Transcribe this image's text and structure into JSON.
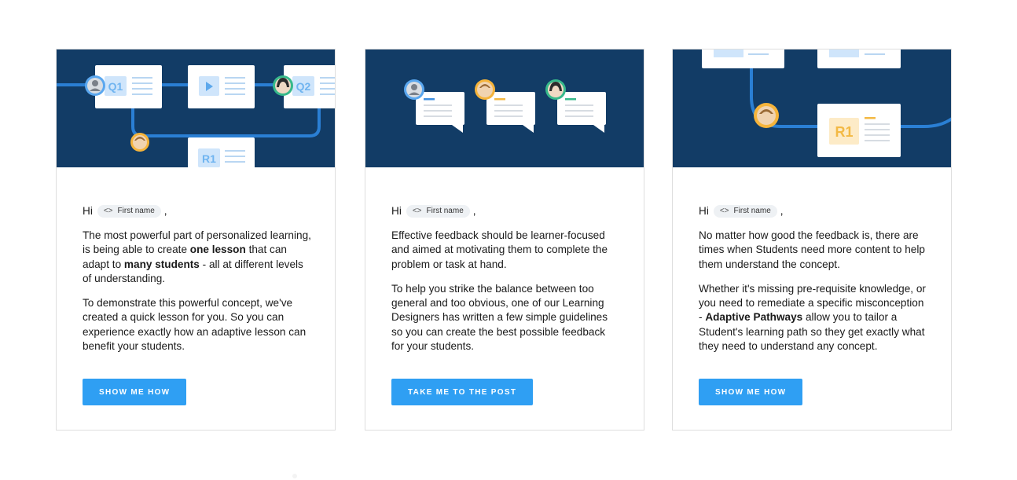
{
  "colors": {
    "hero_bg": "#123c66",
    "path": "#2a7fd4",
    "cta": "#2f9ff3",
    "q_badge": "#cfe5fb",
    "q_text": "#6fb4f0",
    "r_badge": "#fdebc7",
    "r_text": "#f3b944"
  },
  "cards": [
    {
      "greeting": "Hi",
      "chip_icon": "<>",
      "chip_label": "First name",
      "comma": ",",
      "p1": {
        "a": "The most powerful part of personalized learning, is being able to create ",
        "b": "one lesson",
        "c": " that can adapt to ",
        "d": "many students",
        "e": " - all at different levels of understanding."
      },
      "p2": "To demonstrate this powerful concept, we've created a quick lesson for you. So you can experience exactly how an adaptive lesson can benefit your students.",
      "cta": "SHOW ME HOW",
      "hero": {
        "badge_q1": "Q1",
        "badge_q2": "Q2",
        "badge_r1": "R1",
        "icons": [
          "avatar-icon",
          "play-icon"
        ]
      }
    },
    {
      "greeting": "Hi",
      "chip_icon": "<>",
      "chip_label": "First name",
      "comma": ",",
      "p1": "Effective feedback should be learner-focused and aimed at motivating them to complete the problem or task at hand.",
      "p2": "To help you strike the balance between too general and too obvious, one of our Learning Designers has written a few simple guidelines so you can create the best possible feedback for your students.",
      "cta": "TAKE ME TO THE POST",
      "hero": {
        "icons": [
          "avatar-icon",
          "speech-bubble-icon"
        ]
      }
    },
    {
      "greeting": "Hi",
      "chip_icon": "<>",
      "chip_label": "First name",
      "comma": ",",
      "p1": "No matter how good the feedback is, there are times when Students need more content to help them understand the concept.",
      "p2": {
        "a": "Whether it's missing pre-requisite knowledge, or you need to remediate a specific misconception - ",
        "b": "Adaptive Pathways",
        "c": " allow you to tailor a Student's learning path so they get exactly what they need to understand any concept."
      },
      "cta": "SHOW ME HOW",
      "hero": {
        "badge_r1": "R1",
        "icons": [
          "avatar-icon"
        ]
      }
    }
  ]
}
